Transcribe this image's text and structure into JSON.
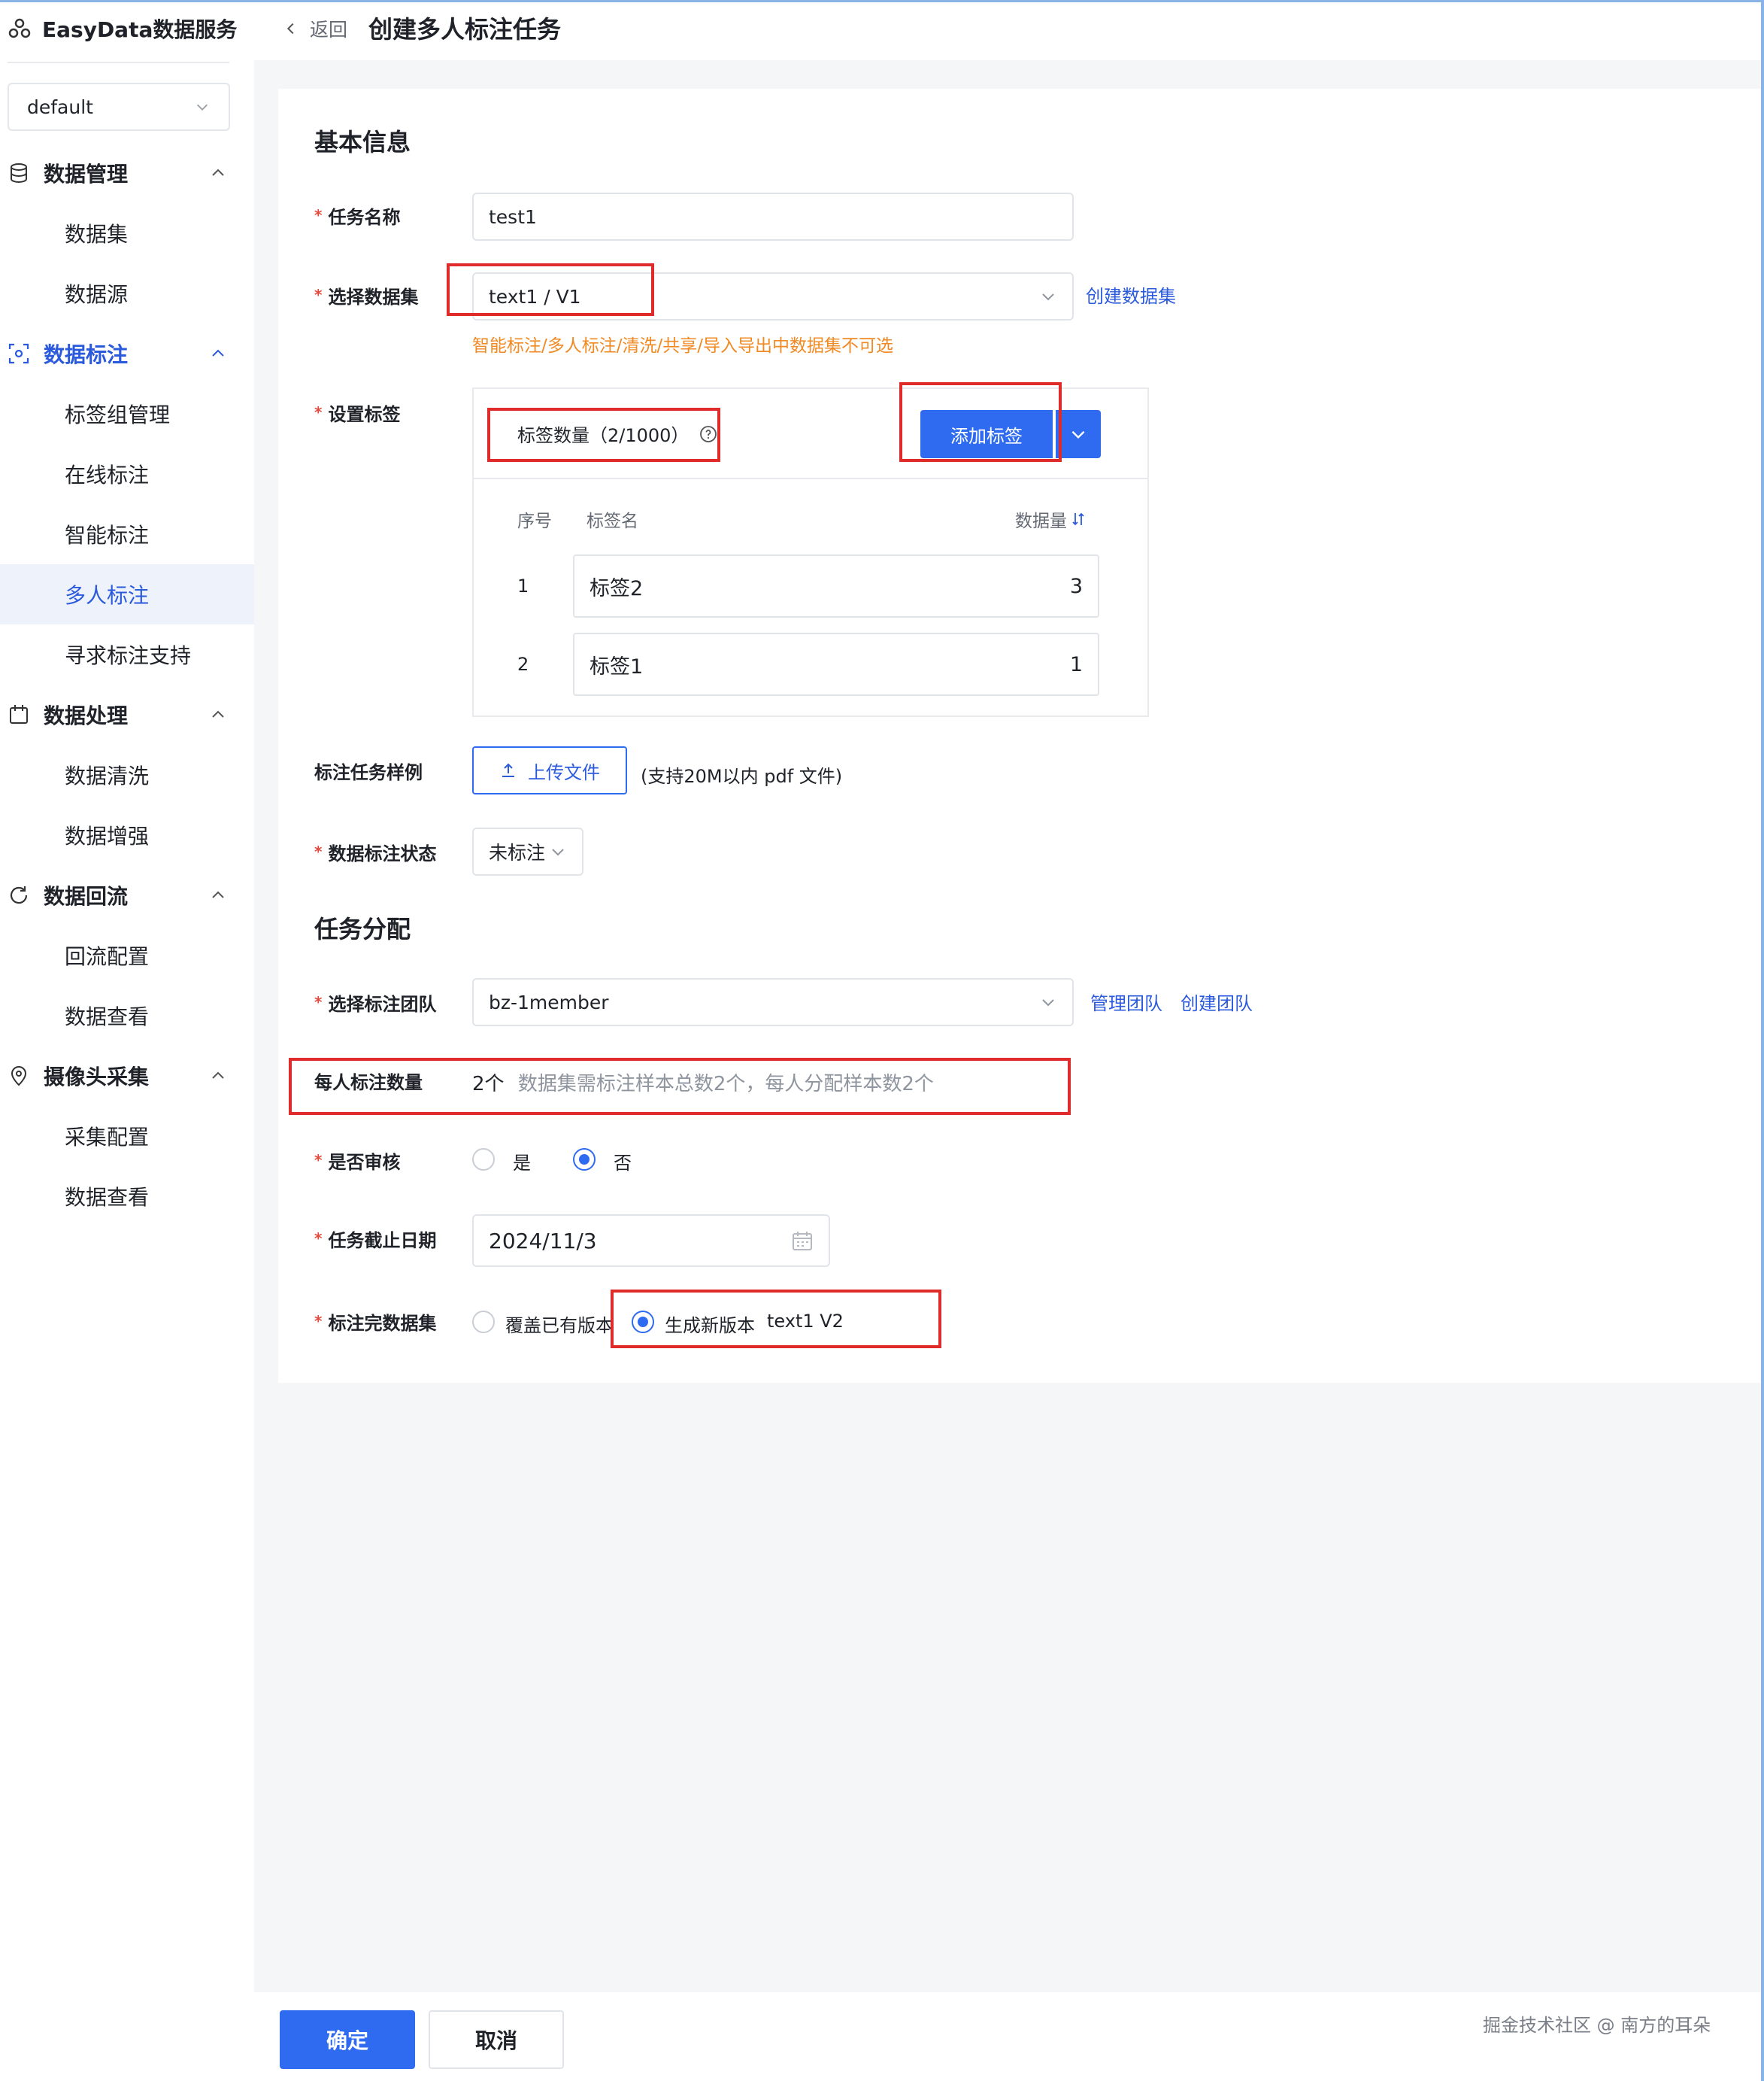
{
  "sidebar": {
    "brand": "EasyData数据服务",
    "workspace": "default",
    "groups": [
      {
        "label": "数据管理",
        "items": [
          "数据集",
          "数据源"
        ]
      },
      {
        "label": "数据标注",
        "items": [
          "标签组管理",
          "在线标注",
          "智能标注",
          "多人标注",
          "寻求标注支持"
        ]
      },
      {
        "label": "数据处理",
        "items": [
          "数据清洗",
          "数据增强"
        ]
      },
      {
        "label": "数据回流",
        "items": [
          "回流配置",
          "数据查看"
        ]
      },
      {
        "label": "摄像头采集",
        "items": [
          "采集配置",
          "数据查看"
        ]
      }
    ],
    "active_group": "数据标注",
    "active_item": "多人标注"
  },
  "header": {
    "back": "返回",
    "title": "创建多人标注任务"
  },
  "basic": {
    "section_title": "基本信息",
    "task_name_label": "任务名称",
    "task_name_value": "test1",
    "dataset_label": "选择数据集",
    "dataset_value": "text1 / V1",
    "create_dataset_link": "创建数据集",
    "dataset_hint": "智能标注/多人标注/清洗/共享/导入导出中数据集不可选",
    "tags_label": "设置标签",
    "tag_count": "标签数量（2/1000）",
    "add_tag_button": "添加标签",
    "table_headers": {
      "index": "序号",
      "name": "标签名",
      "count": "数据量"
    },
    "tags": [
      {
        "index": "1",
        "name": "标签2",
        "count": "3"
      },
      {
        "index": "2",
        "name": "标签1",
        "count": "1"
      }
    ],
    "sample_label": "标注任务样例",
    "upload_button": "上传文件",
    "upload_hint": "(支持20M以内 pdf 文件)",
    "status_label": "数据标注状态",
    "status_value": "未标注"
  },
  "assign": {
    "section_title": "任务分配",
    "team_label": "选择标注团队",
    "team_value": "bz-1member",
    "manage_team_link": "管理团队",
    "create_team_link": "创建团队",
    "per_person_label": "每人标注数量",
    "per_person_value": "2个",
    "per_person_hint": "数据集需标注样本总数2个，每人分配样本数2个",
    "review_label": "是否审核",
    "review_yes": "是",
    "review_no": "否",
    "review_selected": "否",
    "deadline_label": "任务截止日期",
    "deadline_value": "2024/11/3",
    "result_label": "标注完数据集",
    "result_overwrite": "覆盖已有版本",
    "result_new": "生成新版本",
    "result_new_version": "text1 V2",
    "result_selected": "生成新版本"
  },
  "footer": {
    "ok": "确定",
    "cancel": "取消",
    "watermark": "掘金技术社区 @ 南方的耳朵"
  },
  "colors": {
    "primary": "#2f6bf0",
    "required": "#e5483c",
    "warning": "#f08a24",
    "highlight": "#e02b2b"
  }
}
